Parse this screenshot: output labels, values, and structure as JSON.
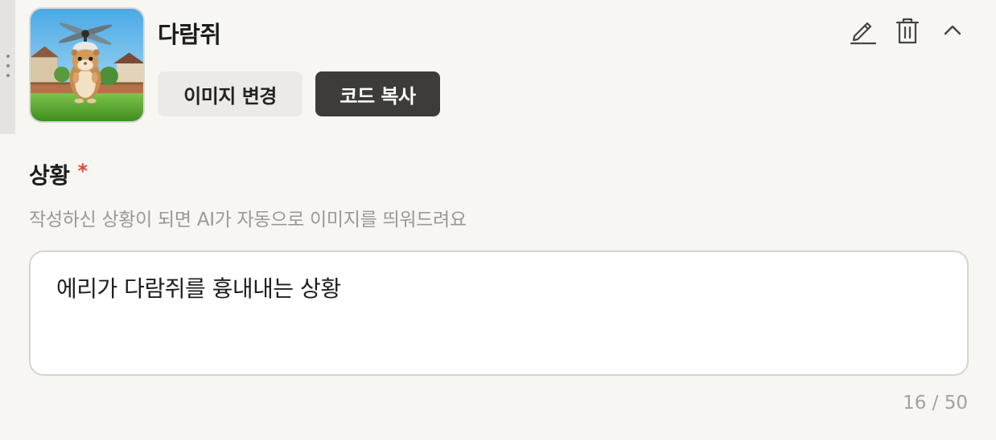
{
  "card": {
    "title": "다람쥐",
    "change_image_label": "이미지 변경",
    "copy_code_label": "코드 복사"
  },
  "icons": {
    "drag": "drag-handle-icon",
    "edit": "pencil-icon",
    "delete": "trash-icon",
    "collapse": "chevron-up-icon"
  },
  "situation": {
    "label": "상황",
    "required_mark": "*",
    "hint": "작성하신 상황이 되면 AI가 자동으로 이미지를 띄워드려요",
    "value": "에리가 다람쥐를 흉내내는 상황",
    "char_count": "16 / 50"
  },
  "colors": {
    "background": "#f7f6f3",
    "primary_button": "#3d3c3a",
    "secondary_button": "#ebeae7",
    "required": "#e8453c",
    "hint_text": "#9a9893"
  }
}
